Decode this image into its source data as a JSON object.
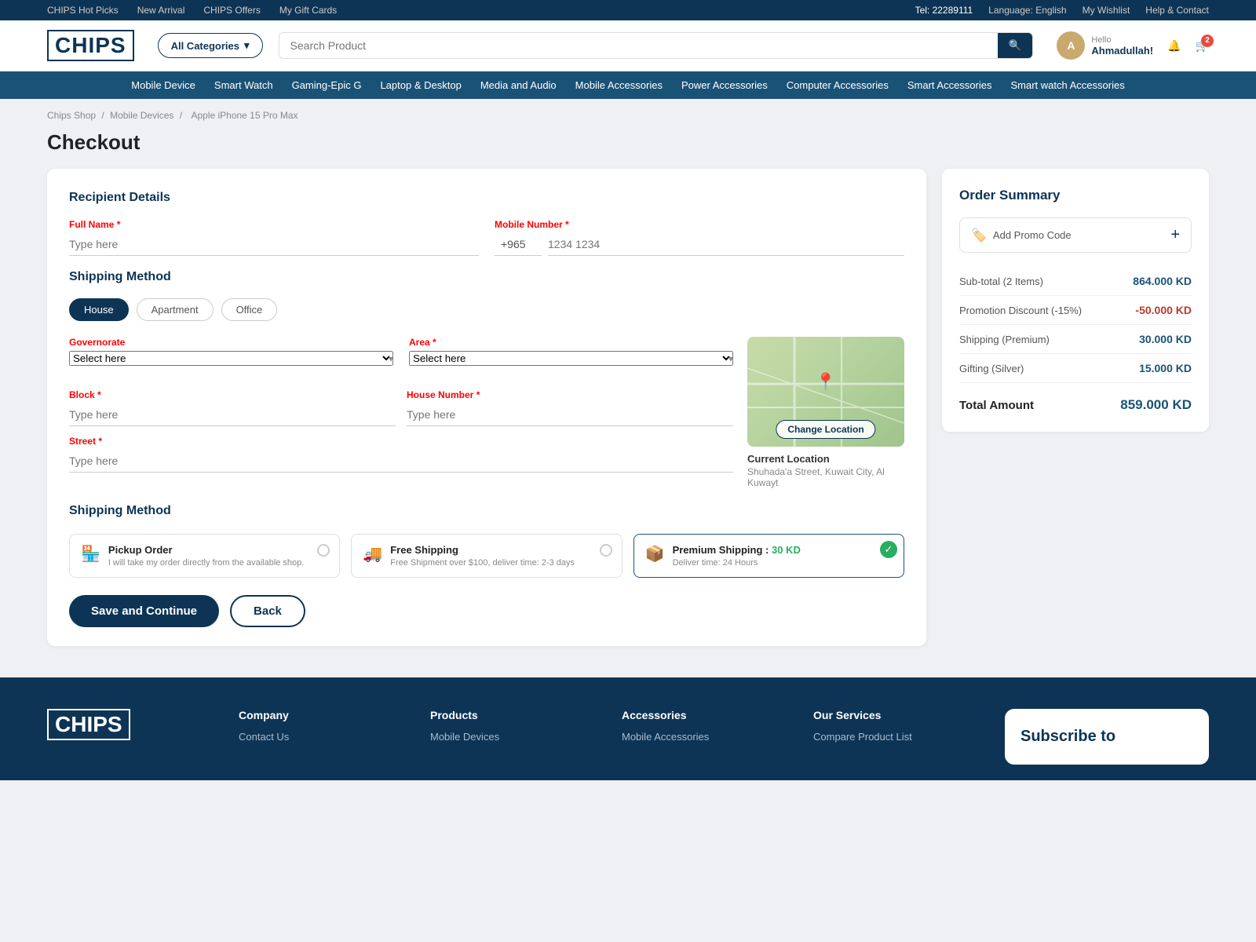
{
  "topbar": {
    "links": [
      "CHIPS Hot Picks",
      "New Arrival",
      "CHIPS Offers",
      "My Gift Cards"
    ],
    "tel": "Tel: 22289111",
    "language": "Language: English",
    "wishlist": "My Wishlist",
    "help": "Help & Contact"
  },
  "header": {
    "logo": "CHIPS",
    "categories_label": "All Categories",
    "search_placeholder": "Search Product",
    "user_greeting": "Hello",
    "user_name": "Ahmadullah!",
    "cart_count": "2"
  },
  "nav": {
    "items": [
      "Mobile Device",
      "Smart Watch",
      "Gaming-Epic G",
      "Laptop & Desktop",
      "Media and Audio",
      "Mobile Accessories",
      "Power Accessories",
      "Computer Accessories",
      "Smart Accessories",
      "Smart watch Accessories"
    ]
  },
  "breadcrumb": {
    "items": [
      "Chips Shop",
      "Mobile Devices",
      "Apple iPhone 15 Pro Max"
    ]
  },
  "page": {
    "title": "Checkout"
  },
  "recipient": {
    "title": "Recipient Details",
    "full_name_label": "Full Name",
    "full_name_placeholder": "Type here",
    "mobile_label": "Mobile Number",
    "phone_prefix": "+965",
    "phone_placeholder": "1234 1234"
  },
  "shipping_method_section": {
    "title": "Shipping Method",
    "tabs": [
      "House",
      "Apartment",
      "Office"
    ],
    "active_tab": "House"
  },
  "address": {
    "governorate_label": "Governorate",
    "governorate_placeholder": "Select here",
    "area_label": "Area",
    "area_placeholder": "Select here",
    "block_label": "Block",
    "block_placeholder": "Type here",
    "house_number_label": "House Number",
    "house_number_placeholder": "Type here",
    "street_label": "Street",
    "street_placeholder": "Type here"
  },
  "map": {
    "change_location_btn": "Change Location",
    "current_location_title": "Current Location",
    "current_location_address": "Shuhada'a Street, Kuwait City, Al Kuwayt"
  },
  "delivery": {
    "title": "Shipping Method",
    "options": [
      {
        "icon": "🏪",
        "title": "Pickup Order",
        "price": "",
        "desc": "I will take my order directly from the available shop.",
        "selected": false
      },
      {
        "icon": "🚚",
        "title": "Free Shipping",
        "price": "",
        "desc": "Free Shipment over $100, deliver time: 2-3 days",
        "selected": false
      },
      {
        "icon": "📦",
        "title": "Premium Shipping :",
        "price": "30 KD",
        "desc": "Deliver time: 24 Hours",
        "selected": true
      }
    ]
  },
  "actions": {
    "save_label": "Save and Continue",
    "back_label": "Back"
  },
  "order_summary": {
    "title": "Order Summary",
    "promo_label": "Add Promo Code",
    "lines": [
      {
        "label": "Sub-total (2 Items)",
        "value": "864.000 KD",
        "negative": false
      },
      {
        "label": "Promotion Discount (-15%)",
        "value": "-50.000 KD",
        "negative": true
      },
      {
        "label": "Shipping (Premium)",
        "value": "30.000 KD",
        "negative": false
      },
      {
        "label": "Gifting (Silver)",
        "value": "15.000 KD",
        "negative": false
      }
    ],
    "total_label": "Total Amount",
    "total_value": "859.000 KD"
  },
  "footer": {
    "logo": "CHIPS",
    "company_title": "Company",
    "company_links": [
      "Contact Us"
    ],
    "products_title": "Products",
    "products_links": [
      "Mobile Devices"
    ],
    "accessories_title": "Accessories",
    "accessories_links": [
      "Mobile Accessories"
    ],
    "services_title": "Our Services",
    "services_links": [
      "Compare Product List"
    ],
    "subscribe_title": "Subscribe to"
  }
}
